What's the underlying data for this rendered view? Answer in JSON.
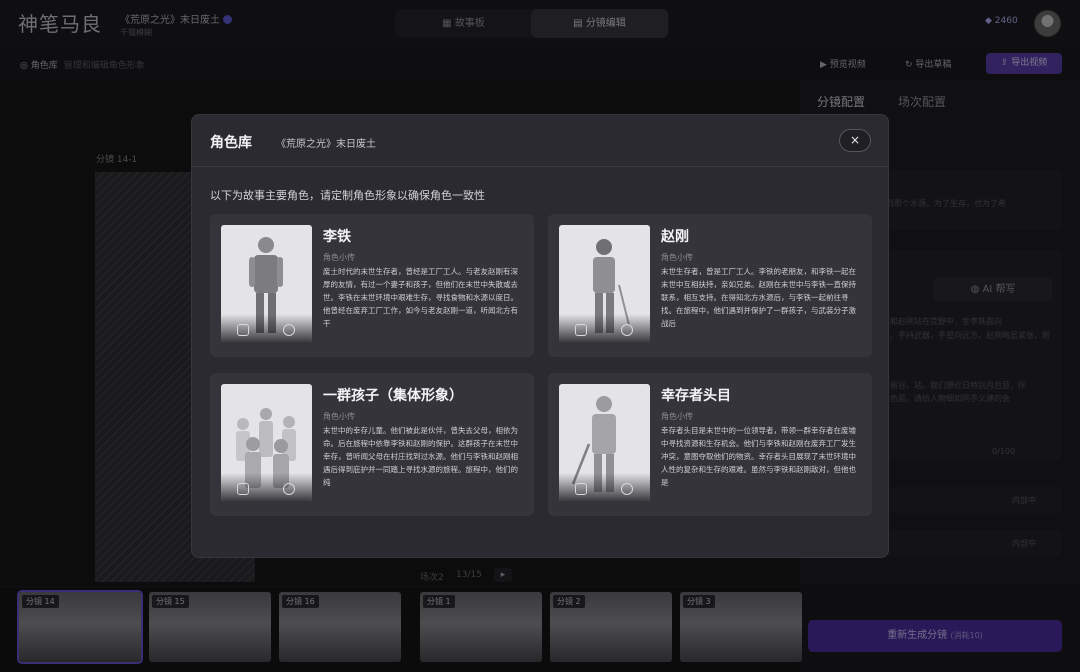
{
  "app": {
    "logo": "神笔马良",
    "project_title": "《荒原之光》末日废土",
    "project_sub": "千猫模糊",
    "credits": "2460"
  },
  "topnav": {
    "tabs": [
      {
        "label": "故事板"
      },
      {
        "label": "分镜编辑"
      }
    ]
  },
  "subbar": {
    "character_lib": "角色库",
    "hint": "管理和编辑角色形象",
    "preview": "预览视频",
    "export_draft": "导出草稿",
    "export_video": "导出视频"
  },
  "main": {
    "shot_label": "分镜 14-1"
  },
  "right_panel": {
    "tabs": [
      {
        "label": "分镜配置"
      },
      {
        "label": "场次配置"
      }
    ],
    "text_1": "试图找到那个水源。为了生存，也为了希",
    "ai_help": "AI 帮写",
    "text_2": "和赵刚站在荒野中，金李铁面向",
    "text_3": "。手持武器，手望向远方。赵刚略显紧张，眼",
    "text_4": "留谷。站。我们想近日特别月后意，伴",
    "text_5": "色面。请给人物细如同手义建的会",
    "counter": "0/100",
    "status_1": "内部中",
    "status_2": "内部中",
    "regen_label": "重新生成分镜",
    "regen_cost": "(消耗10)"
  },
  "scene_bar": {
    "label": "场次2",
    "page": "13/15"
  },
  "filmstrip": [
    {
      "label": "分镜 14"
    },
    {
      "label": "分镜 15"
    },
    {
      "label": "分镜 16"
    },
    {
      "label": "分镜 1"
    },
    {
      "label": "分镜 2"
    },
    {
      "label": "分镜 3"
    }
  ],
  "modal": {
    "title": "角色库",
    "subtitle": "《荒原之光》末日废土",
    "close": "×",
    "description": "以下为故事主要角色，请定制角色形象以确保角色一致性",
    "characters": [
      {
        "name": "李铁",
        "label": "角色小传",
        "bio": "废土时代的末世生存者，曾经是工厂工人。与老友赵刚有深厚的友情，有过一个妻子和孩子，但他们在末世中失散或去世。李铁在末世环境中艰难生存，寻找食物和水源以度日。他曾经在废弃工厂工作，如今与老友赵刚一道，听闻北方有干"
      },
      {
        "name": "赵刚",
        "label": "角色小传",
        "bio": "末世生存者，曾是工厂工人。李铁的老朋友，和李铁一起在末世中互相扶持，亲如兄弟。赵刚在末世中与李铁一直保持联系，相互支持。在得知北方水源后，与李铁一起前往寻找。在旅程中，他们遇到并保护了一群孩子，与武装分子激战后"
      },
      {
        "name": "一群孩子（集体形象）",
        "label": "角色小传",
        "bio": "末世中的幸存儿童。他们被此是伙伴，曾失去父母，相依为命。后在旅程中依靠李铁和赵刚的保护。这群孩子在末世中幸存，曾听闻父母在村庄找到过水源。他们与李铁和赵刚相遇后得到庇护并一同踏上寻找水源的旅程。旅程中，他们的纯"
      },
      {
        "name": "幸存者头目",
        "label": "角色小传",
        "bio": "幸存者头目是末世中的一位领导者，带领一群幸存者在废墟中寻找资源和生存机会。他们与李铁和赵刚在废弃工厂发生冲突，意图夺取他们的物资。幸存者头目展现了末世环境中人性的复杂和生存的艰难。虽然与李铁和赵刚敌对，但他也是"
      }
    ]
  },
  "colors": {
    "accent": "#5b3fb0",
    "modal_bg": "#2a2a30",
    "card_bg": "#34343a",
    "selected_outline": "#6b55d8"
  }
}
